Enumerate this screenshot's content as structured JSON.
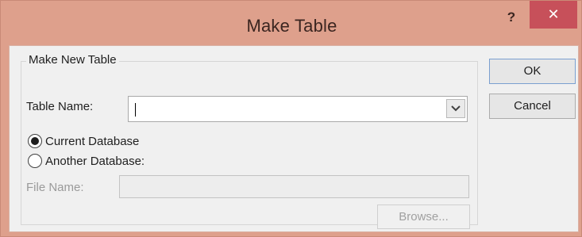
{
  "window": {
    "title": "Make Table",
    "help_label": "?",
    "close_label": "✕"
  },
  "group": {
    "legend": "Make New Table",
    "table_name_label": "Table Name:",
    "table_name_value": "",
    "dropdown_icon": "chevron-down-icon",
    "radio_current": {
      "label": "Current Database",
      "checked": true
    },
    "radio_another": {
      "label": "Another Database:",
      "checked": false
    },
    "file_name_label": "File Name:",
    "file_name_value": "",
    "browse_label": "Browse..."
  },
  "buttons": {
    "ok_label": "OK",
    "cancel_label": "Cancel"
  }
}
